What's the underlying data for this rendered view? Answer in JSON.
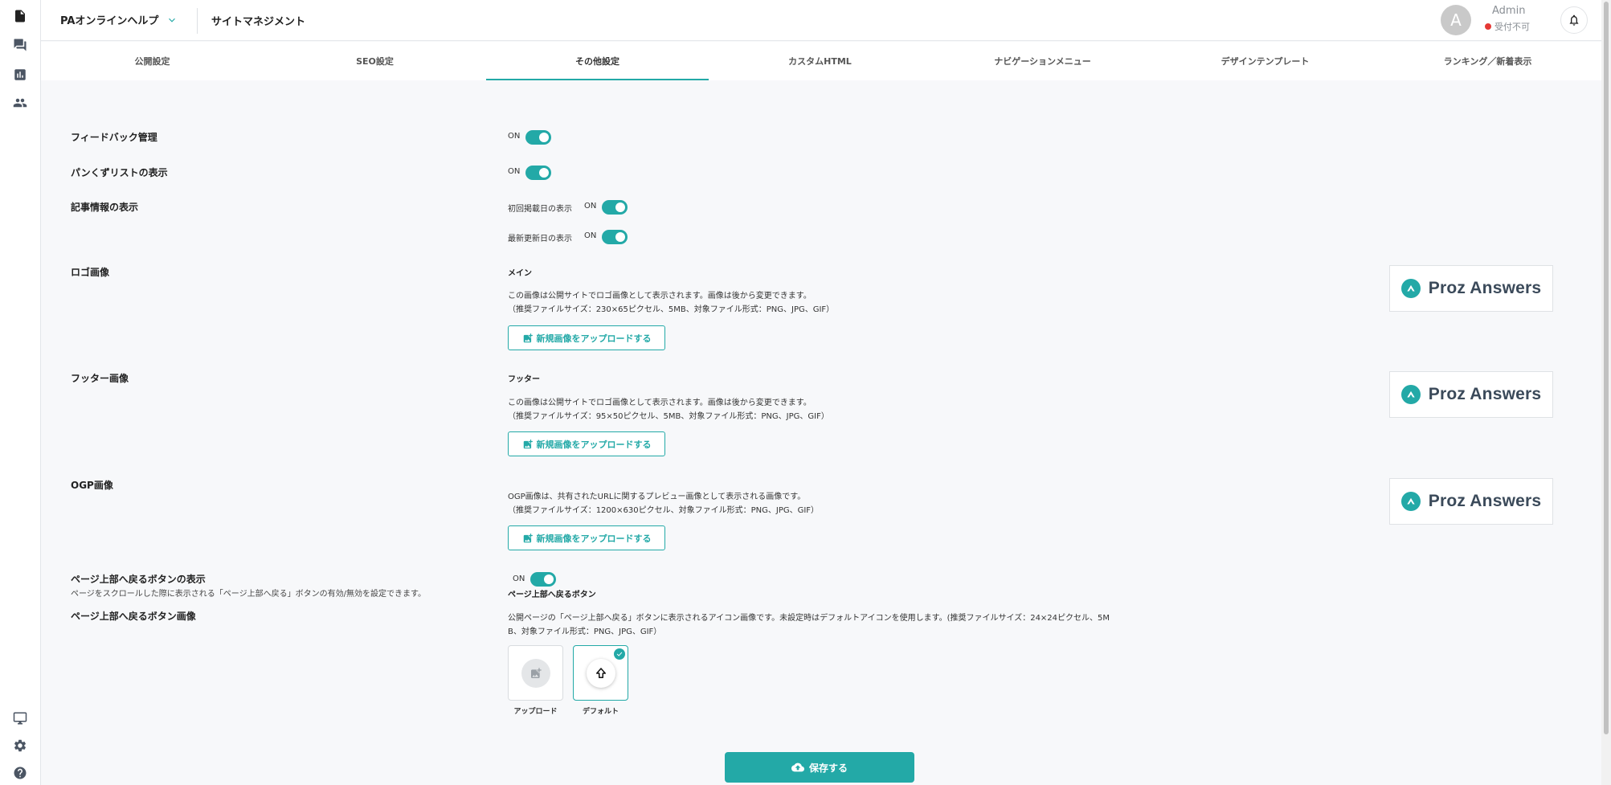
{
  "header": {
    "site_name": "PAオンラインヘルプ",
    "section": "サイトマネジメント",
    "user": {
      "avatar_letter": "A",
      "name": "Admin",
      "status": "受付不可"
    }
  },
  "rail_icons": [
    "document-icon",
    "chat-icon",
    "chart-icon",
    "users-icon",
    "monitor-icon",
    "gear-icon",
    "help-icon"
  ],
  "tabs": [
    {
      "label": "公開設定",
      "active": false
    },
    {
      "label": "SEO設定",
      "active": false
    },
    {
      "label": "その他設定",
      "active": true
    },
    {
      "label": "カスタムHTML",
      "active": false
    },
    {
      "label": "ナビゲーションメニュー",
      "active": false
    },
    {
      "label": "デザインテンプレート",
      "active": false
    },
    {
      "label": "ランキング／新着表示",
      "active": false
    }
  ],
  "settings": {
    "feedback": {
      "label": "フィードバック管理",
      "state": "ON"
    },
    "breadcrumb": {
      "label": "パンくずリストの表示",
      "state": "ON"
    },
    "article_info": {
      "label": "記事情報の表示",
      "first_date": {
        "label": "初回掲載日の表示",
        "state": "ON"
      },
      "updated_date": {
        "label": "最新更新日の表示",
        "state": "ON"
      }
    },
    "logo": {
      "label": "ロゴ画像",
      "sub_label": "メイン",
      "desc1": "この画像は公開サイトでロゴ画像として表示されます。画像は後から変更できます。",
      "desc2": "（推奨ファイルサイズ：230×65ピクセル、5MB、対象ファイル形式：PNG、JPG、GIF）",
      "button": "新規画像をアップロードする",
      "preview": "Proz Answers"
    },
    "footer": {
      "label": "フッター画像",
      "sub_label": "フッター",
      "desc1": "この画像は公開サイトでロゴ画像として表示されます。画像は後から変更できます。",
      "desc2": "（推奨ファイルサイズ：95×50ピクセル、5MB、対象ファイル形式：PNG、JPG、GIF）",
      "button": "新規画像をアップロードする",
      "preview": "Proz Answers"
    },
    "ogp": {
      "label": "OGP画像",
      "desc1": "OGP画像は、共有されたURLに関するプレビュー画像として表示される画像です。",
      "desc2": "（推奨ファイルサイズ：1200×630ピクセル、対象ファイル形式：PNG、JPG、GIF）",
      "button": "新規画像をアップロードする",
      "preview": "Proz Answers"
    },
    "back_to_top": {
      "label": "ページ上部へ戻るボタンの表示",
      "description": "ページをスクロールした際に表示される「ページ上部へ戻る」ボタンの有効/無効を設定できます。",
      "state": "ON",
      "sub_label": "ページ上部へ戻るボタン"
    },
    "back_to_top_image": {
      "label": "ページ上部へ戻るボタン画像",
      "desc1": "公開ページの「ページ上部へ戻る」ボタンに表示されるアイコン画像です。未設定時はデフォルトアイコンを使用します。(推奨ファイルサイズ：24×24ピクセル、5M",
      "desc2": "B、対象ファイル形式：PNG、JPG、GIF）",
      "options": [
        {
          "label": "アップロード",
          "selected": false
        },
        {
          "label": "デフォルト",
          "selected": true
        }
      ]
    }
  },
  "save_button": "保存する",
  "colors": {
    "accent": "#23a9a7",
    "status_red": "#e53935"
  }
}
